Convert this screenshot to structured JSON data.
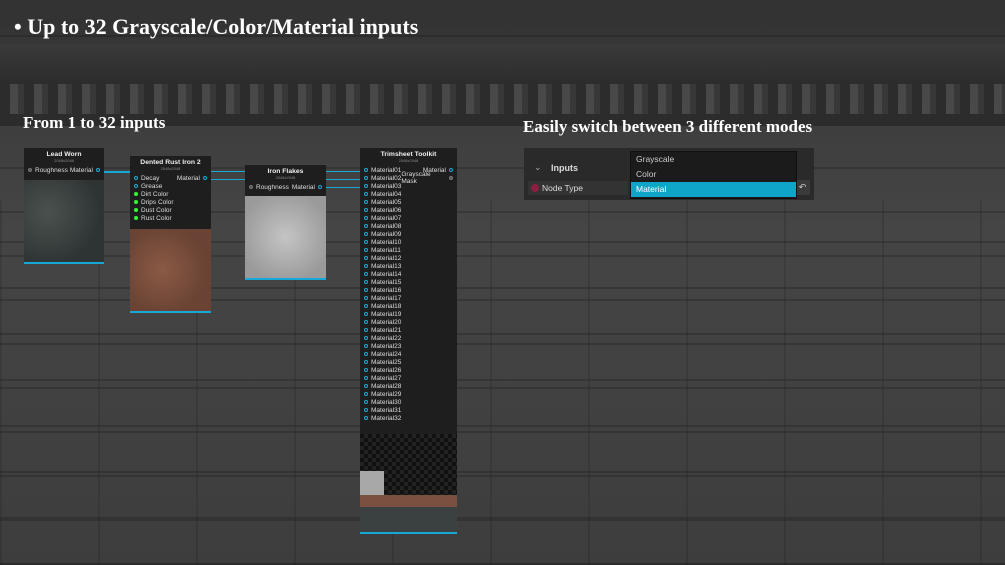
{
  "slide": {
    "title": "• Up to 32 Grayscale/Color/Material inputs",
    "left_caption": "From 1 to 32 inputs",
    "right_caption": "Easily switch between 3 different modes"
  },
  "nodes": {
    "lead_worn": {
      "title": "Lead Worn",
      "res": "2048x2048",
      "in_label": "Roughness",
      "out_label": "Material"
    },
    "dented_rust": {
      "title": "Dented Rust Iron 2",
      "res": "2048x2048",
      "inputs": [
        "Decay",
        "Grease",
        "Dirt Color",
        "Drips Color",
        "Dust Color",
        "Rust Color"
      ],
      "out_label": "Material"
    },
    "iron_flakes": {
      "title": "Iron Flakes",
      "res": "2048x2048",
      "in_label": "Roughness",
      "out_label": "Material"
    },
    "trimsheet": {
      "title": "Trimsheet Toolkit",
      "res": "2048x2048",
      "outputs": [
        "Material",
        "Grayscale Mask"
      ],
      "inputs": [
        "Material01",
        "Material02",
        "Material03",
        "Material04",
        "Material05",
        "Material06",
        "Material07",
        "Material08",
        "Material09",
        "Material10",
        "Material11",
        "Material12",
        "Material13",
        "Material14",
        "Material15",
        "Material16",
        "Material17",
        "Material18",
        "Material19",
        "Material20",
        "Material21",
        "Material22",
        "Material23",
        "Material24",
        "Material25",
        "Material26",
        "Material27",
        "Material28",
        "Material29",
        "Material30",
        "Material31",
        "Material32"
      ]
    }
  },
  "panel": {
    "section_label": "Inputs",
    "property_label": "Node Type",
    "options": [
      "Grayscale",
      "Color",
      "Material"
    ],
    "selected": "Material"
  },
  "colors": {
    "accent": "#18a8d8",
    "selected": "#0ea5c8",
    "node_bg": "#1e1e1e"
  },
  "icons": {
    "reset": "reset-icon",
    "chevron": "chevron-down-icon"
  }
}
